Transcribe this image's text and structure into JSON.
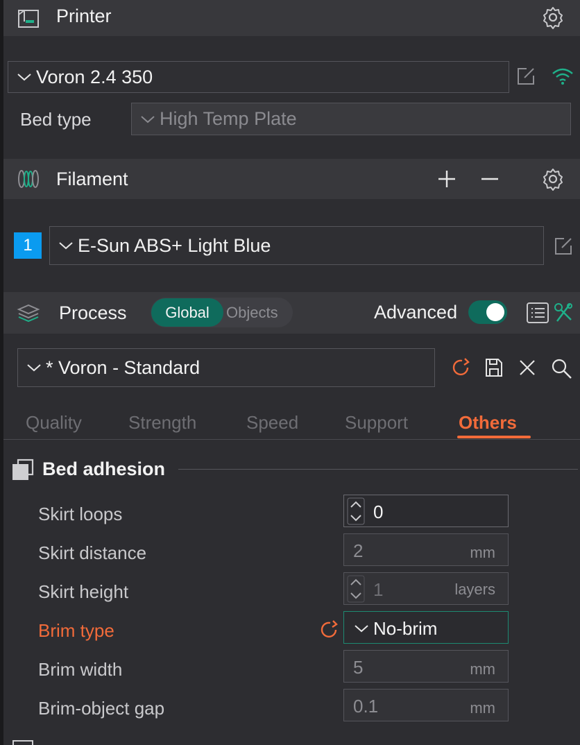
{
  "printer": {
    "title": "Printer",
    "selected_printer": "Voron 2.4 350",
    "bed_type_label": "Bed type",
    "bed_type_value": "High Temp Plate"
  },
  "filament": {
    "title": "Filament",
    "slot_number": "1",
    "selected_filament": "E-Sun ABS+ Light Blue"
  },
  "process": {
    "title": "Process",
    "seg_global": "Global",
    "seg_objects": "Objects",
    "advanced_label": "Advanced",
    "advanced_on": true,
    "selected_preset": "* Voron - Standard"
  },
  "tabs": [
    {
      "label": "Quality",
      "active": false
    },
    {
      "label": "Strength",
      "active": false
    },
    {
      "label": "Speed",
      "active": false
    },
    {
      "label": "Support",
      "active": false
    },
    {
      "label": "Others",
      "active": true
    }
  ],
  "bed_adhesion": {
    "title": "Bed adhesion",
    "rows": [
      {
        "label": "Skirt loops",
        "value": "0",
        "unit": ""
      },
      {
        "label": "Skirt distance",
        "value": "2",
        "unit": "mm"
      },
      {
        "label": "Skirt height",
        "value": "1",
        "unit": "layers"
      },
      {
        "label": "Brim type",
        "value": "No-brim",
        "unit": ""
      },
      {
        "label": "Brim width",
        "value": "5",
        "unit": "mm"
      },
      {
        "label": "Brim-object gap",
        "value": "0.1",
        "unit": "mm"
      }
    ]
  },
  "colors": {
    "accent_green": "#0f6b5c",
    "modified_orange": "#f26b3a",
    "filament_blue": "#0a9bf0",
    "wifi_green": "#1fb08a"
  }
}
